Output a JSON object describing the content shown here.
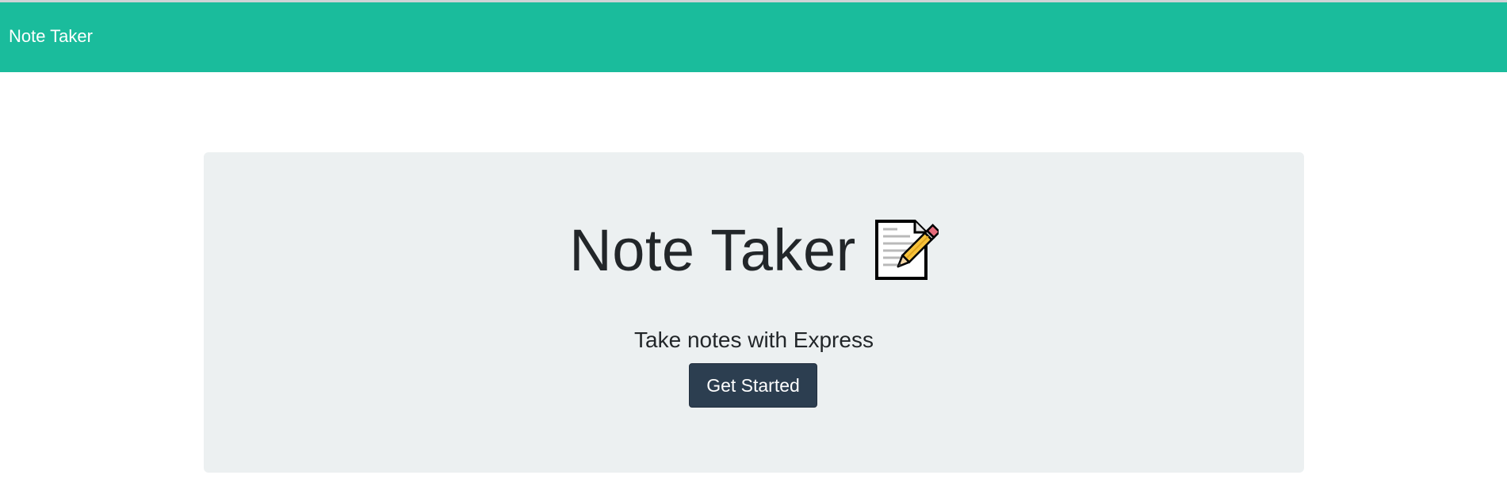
{
  "navbar": {
    "brand": "Note Taker",
    "color": "#1abc9c"
  },
  "hero": {
    "title": "Note Taker",
    "icon": "memo-icon",
    "lead": "Take notes with Express",
    "cta_label": "Get Started",
    "cta_color": "#2c3e50",
    "background": "#ecf0f1"
  }
}
